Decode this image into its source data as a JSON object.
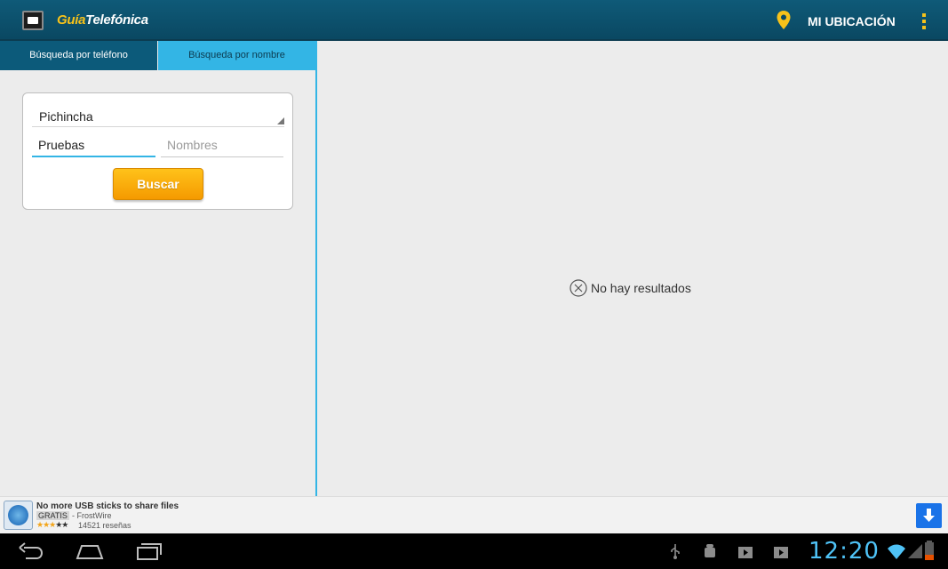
{
  "app": {
    "title_part1": "Guía",
    "title_part2": "Telefónica",
    "location_label": "MI UBICACIÓN",
    "accent_color": "#f7c21a",
    "bar_color": "#0f5a78"
  },
  "tabs": [
    {
      "label": "Búsqueda por teléfono",
      "selected": true
    },
    {
      "label": "Búsqueda por nombre",
      "selected": false
    }
  ],
  "search": {
    "province": "Pichincha",
    "surname_value": "Pruebas",
    "names_placeholder": "Nombres",
    "submit_label": "Buscar"
  },
  "results": {
    "empty_message": "No hay resultados",
    "icon": "close-circle-icon"
  },
  "ad": {
    "title": "No more USB sticks to share files",
    "badge": "GRATIS",
    "advertiser": "- FrostWire",
    "rating_stars": "★★★",
    "rating_stars_dim": "★★",
    "rating": 3,
    "rating_max": 5,
    "reviews": "14521 reseñas"
  },
  "system": {
    "clock": "12:20"
  }
}
